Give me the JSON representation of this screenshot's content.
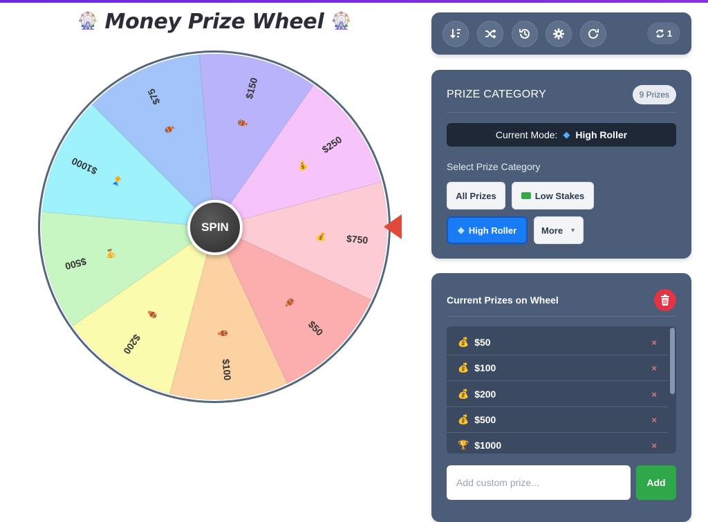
{
  "title": {
    "text": "Money Prize Wheel",
    "emoji_left": "🎡",
    "emoji_right": "🎡"
  },
  "wheel": {
    "spin_label": "SPIN",
    "segments": [
      {
        "label": "$150",
        "icon": "🏺",
        "color": "#b9b3fb"
      },
      {
        "label": "$250",
        "icon": "💰",
        "color": "#f6c4fb"
      },
      {
        "label": "$750",
        "icon": "💰",
        "color": "#fccbd3"
      },
      {
        "label": "$50",
        "icon": "🏺",
        "color": "#fcadad"
      },
      {
        "label": "$100",
        "icon": "🏺",
        "color": "#fcd2a2"
      },
      {
        "label": "$200",
        "icon": "🏺",
        "color": "#fbfbae"
      },
      {
        "label": "$500",
        "icon": "🏆",
        "color": "#c7f6c3"
      },
      {
        "label": "$1000",
        "icon": "🏅",
        "color": "#9ef2fb"
      },
      {
        "label": "$75",
        "icon": "🏺",
        "color": "#a2c4fa"
      }
    ]
  },
  "toolbar": {
    "icons": [
      "sort-icon",
      "shuffle-icon",
      "history-icon",
      "gear-icon",
      "refresh-icon"
    ],
    "counter": "1"
  },
  "category": {
    "title": "PRIZE CATEGORY",
    "count": "9 Prizes",
    "mode_label": "Current Mode:",
    "mode_value": "High Roller",
    "select_label": "Select Prize Category",
    "buttons": [
      "All Prizes",
      "Low Stakes",
      "High Roller",
      "More"
    ]
  },
  "prizes": {
    "title": "Current Prizes on Wheel",
    "items": [
      {
        "icon": "💰",
        "label": "$50"
      },
      {
        "icon": "💰",
        "label": "$100"
      },
      {
        "icon": "💰",
        "label": "$200"
      },
      {
        "icon": "💰",
        "label": "$500"
      },
      {
        "icon": "🏆",
        "label": "$1000"
      }
    ],
    "remove_symbol": "×",
    "input_placeholder": "Add custom prize...",
    "add_label": "Add"
  },
  "colors": {
    "accent_blue": "#1a7cf5",
    "panel": "#4b5d78",
    "danger": "#e03545",
    "success": "#2fa84a",
    "pointer": "#e04a3a"
  }
}
